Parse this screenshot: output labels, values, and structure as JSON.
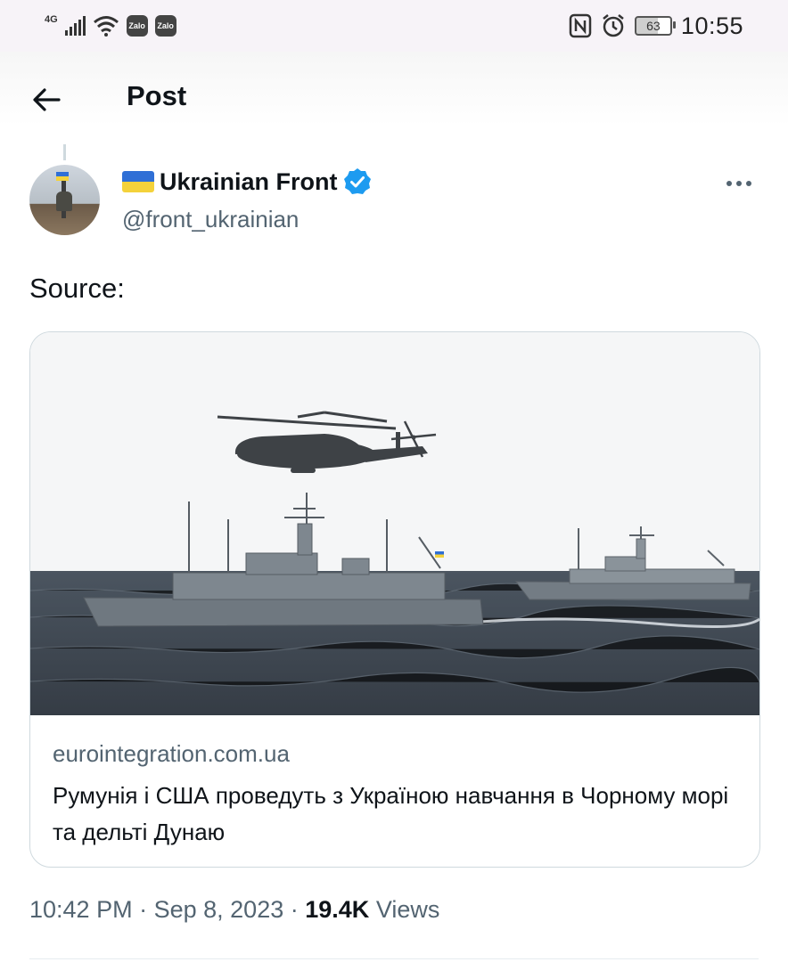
{
  "status_bar": {
    "network": "4G",
    "app_icons": [
      "Zalo",
      "Zalo"
    ],
    "battery": "63",
    "time": "10:55",
    "icons": [
      "signal-icon",
      "wifi-icon",
      "nfc-icon",
      "alarm-icon",
      "battery-icon"
    ]
  },
  "header": {
    "title": "Post"
  },
  "tweet": {
    "author": {
      "name": "Ukrainian Front",
      "handle": "@front_ukrainian",
      "verified": true
    },
    "text": "Source:",
    "card": {
      "domain": "eurointegration.com.ua",
      "title": "Румунія і США проведуть з Україною навчання в Чорному морі та дельті Дунаю"
    },
    "time": "10:42 PM",
    "date": "Sep 8, 2023",
    "views_count": "19.4K",
    "views_label": "Views"
  },
  "colors": {
    "text": "#0f1419",
    "secondary": "#536471",
    "verified": "#1d9bf0",
    "border": "#cfd9de"
  }
}
